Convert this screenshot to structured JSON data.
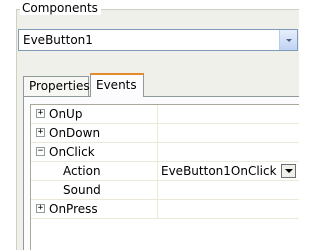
{
  "group": {
    "label": "Components"
  },
  "component_select": {
    "value": "EveButton1"
  },
  "tabs": [
    {
      "label": "Properties",
      "active": false
    },
    {
      "label": "Events",
      "active": true
    }
  ],
  "events": [
    {
      "name": "OnUp",
      "expander": "+",
      "value": ""
    },
    {
      "name": "OnDown",
      "expander": "+",
      "value": ""
    },
    {
      "name": "OnClick",
      "expander": "−",
      "value": ""
    },
    {
      "name": "Action",
      "expander": "",
      "value": "EveButton1OnClick"
    },
    {
      "name": "Sound",
      "expander": "",
      "value": ""
    },
    {
      "name": "OnPress",
      "expander": "+",
      "value": ""
    }
  ]
}
